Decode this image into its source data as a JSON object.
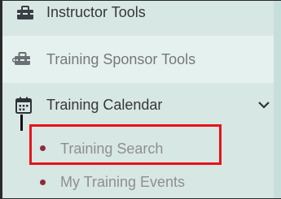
{
  "nav": {
    "items": [
      {
        "label": "Instructor Tools",
        "icon": "toolbox-icon"
      },
      {
        "label": "Training Sponsor Tools",
        "icon": "toolbox-icon"
      },
      {
        "label": "Training Calendar",
        "icon": "calendar-icon",
        "expanded": true,
        "children": [
          {
            "label": "Training Search",
            "highlighted": true
          },
          {
            "label": "My Training Events"
          }
        ]
      }
    ]
  },
  "colors": {
    "sidebar_bg": "#d7e7e4",
    "hover_bg": "#e5f1ef",
    "text": "#373737",
    "muted_text": "#8f8f8f",
    "bullet": "#8a2d3b",
    "highlight_border": "#e8131a"
  }
}
